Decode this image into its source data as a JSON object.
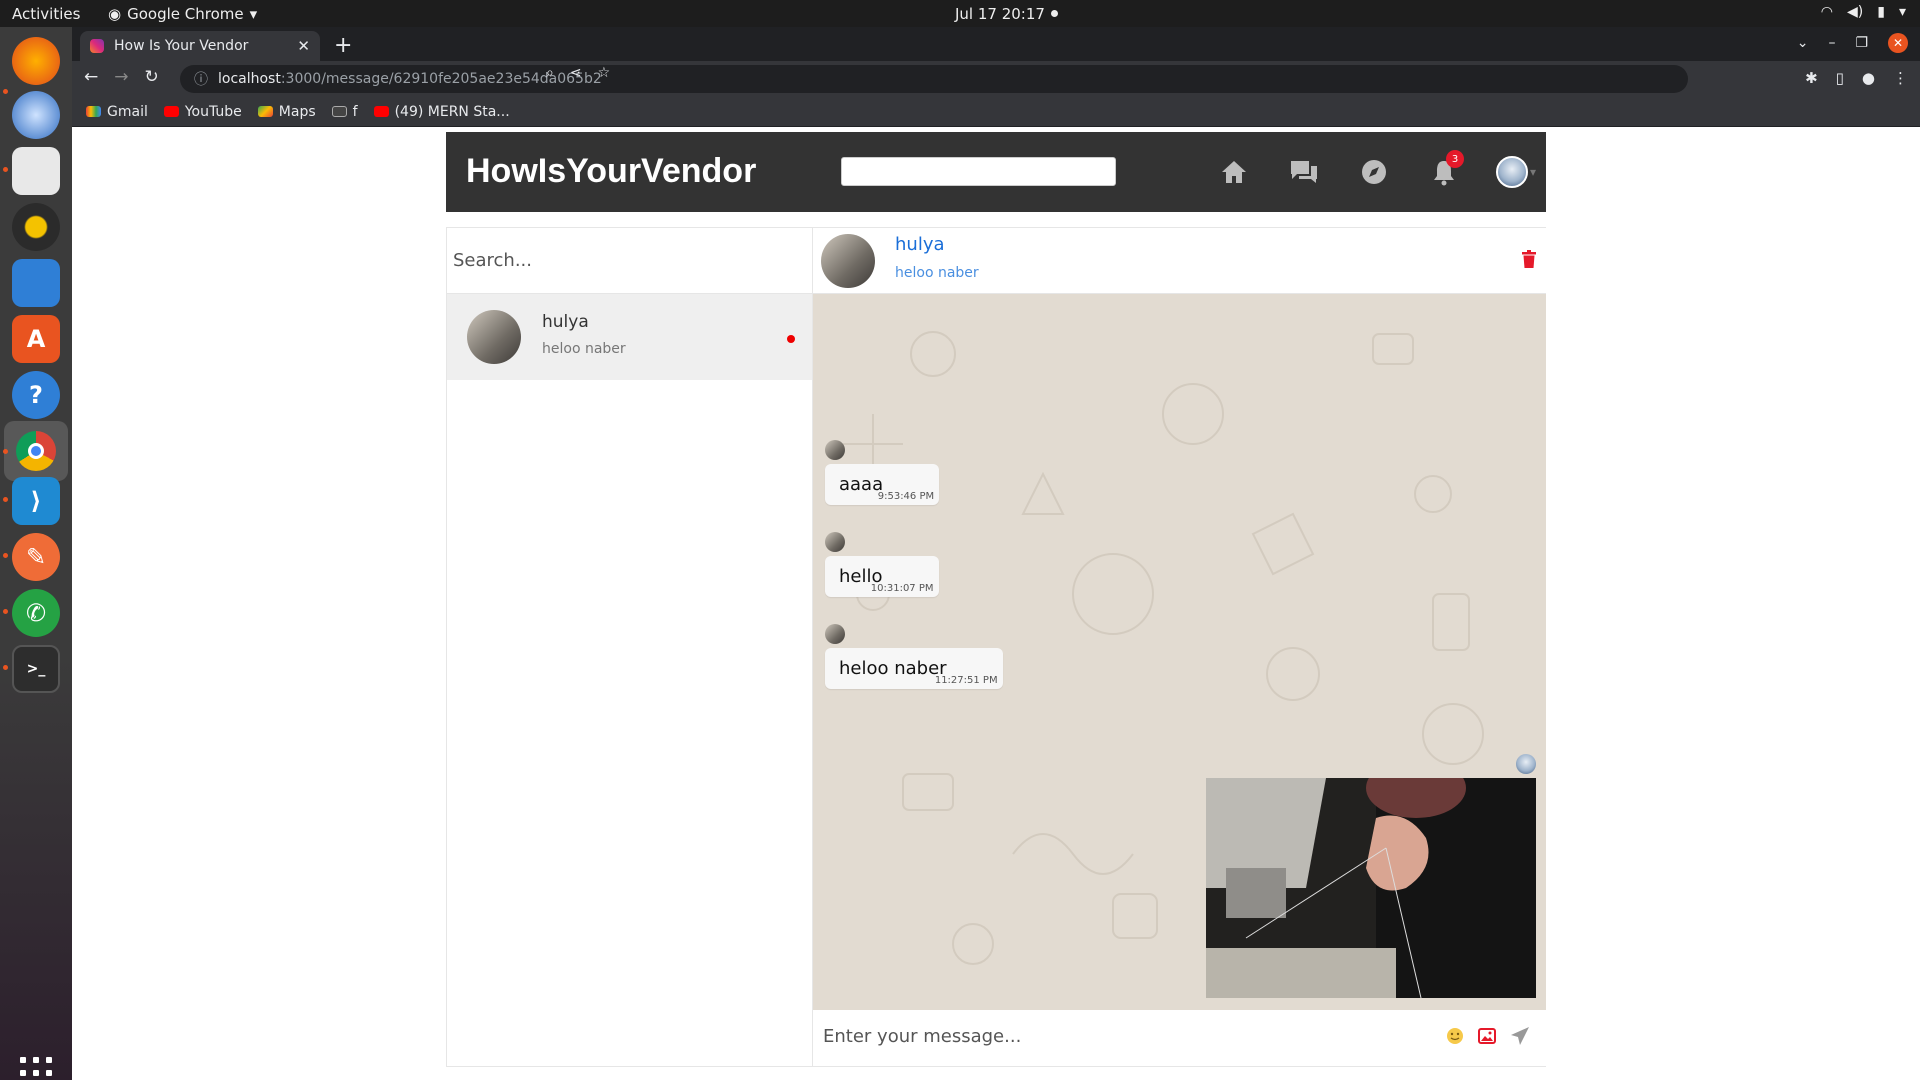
{
  "os": {
    "activities": "Activities",
    "app_menu": "Google Chrome",
    "clock": "Jul 17  20:17"
  },
  "browser": {
    "tab_title": "How Is Your Vendor",
    "url_host": "localhost",
    "url_path": ":3000/message/62910fe205ae23e54da065b2",
    "bookmarks": [
      {
        "label": "Gmail",
        "icon": "gmail-icon"
      },
      {
        "label": "YouTube",
        "icon": "youtube-icon"
      },
      {
        "label": "Maps",
        "icon": "maps-icon"
      },
      {
        "label": "f",
        "icon": "bookmark-icon"
      },
      {
        "label": "(49) MERN Sta...",
        "icon": "youtube-icon"
      }
    ]
  },
  "site": {
    "brand": "HowIsYourVendor",
    "notification_count": "3"
  },
  "sidebar": {
    "search_placeholder": "Search...",
    "conversations": [
      {
        "name": "hulya",
        "last_message": "heloo naber",
        "unread": true
      }
    ]
  },
  "chat": {
    "contact_name": "hulya",
    "contact_last": "heloo naber",
    "messages": [
      {
        "text": "aaaa",
        "time": "9:53:46 PM"
      },
      {
        "text": "hello",
        "time": "10:31:07 PM"
      },
      {
        "text": "heloo naber",
        "time": "11:27:51 PM"
      }
    ],
    "composer_placeholder": "Enter your message..."
  },
  "colors": {
    "navbar": "#333333",
    "accent_link": "#1a6ed8",
    "chat_bg": "#e2dbd1",
    "danger": "#e5192a"
  }
}
